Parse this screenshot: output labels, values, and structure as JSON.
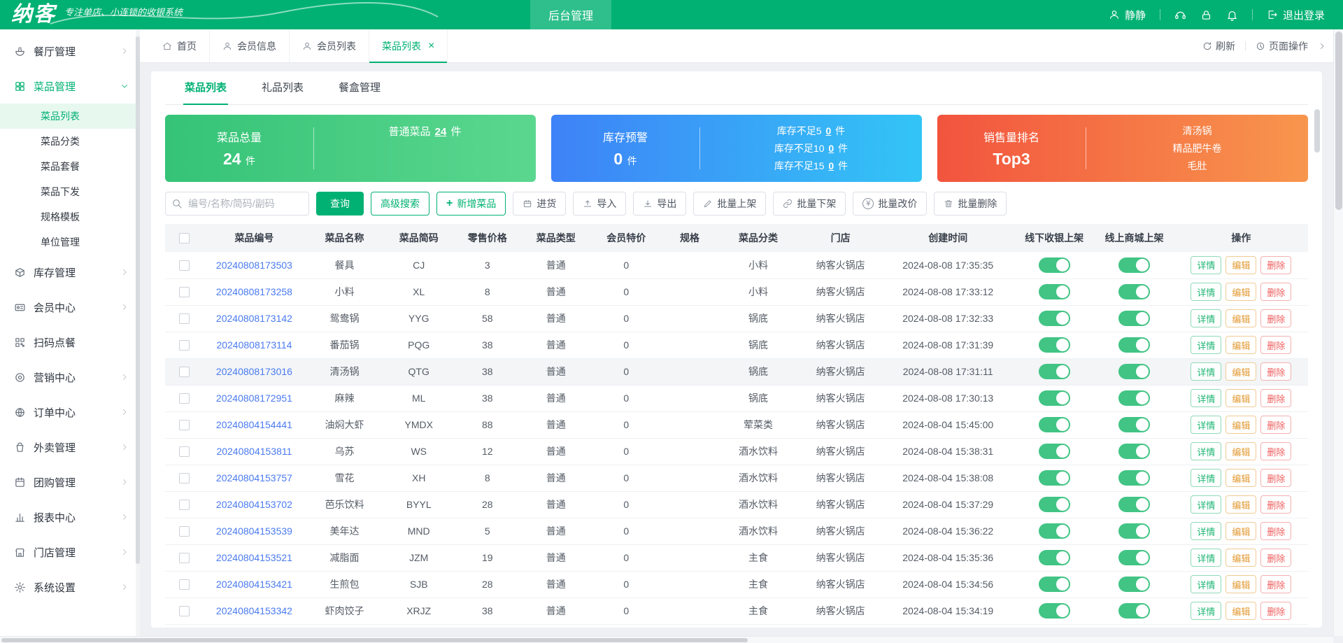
{
  "header": {
    "logo": "纳客",
    "tagline": "专注单店、小连锁的收银系统",
    "admin_tab": "后台管理",
    "username": "静静",
    "logout_label": "退出登录"
  },
  "tab_bar": {
    "tabs": [
      {
        "label": "首页",
        "icon": "home",
        "active": false,
        "closable": false
      },
      {
        "label": "会员信息",
        "icon": "user",
        "active": false,
        "closable": false
      },
      {
        "label": "会员列表",
        "icon": "user",
        "active": false,
        "closable": false
      },
      {
        "label": "菜品列表",
        "icon": "",
        "active": true,
        "closable": true
      }
    ],
    "refresh_label": "刷新",
    "page_ops_label": "页面操作"
  },
  "sidebar": {
    "items": [
      {
        "label": "餐厅管理",
        "icon": "restaurant",
        "expandable": true,
        "expanded": false
      },
      {
        "label": "菜品管理",
        "icon": "dish",
        "expandable": true,
        "expanded": true,
        "children": [
          {
            "label": "菜品列表",
            "active": true
          },
          {
            "label": "菜品分类",
            "active": false
          },
          {
            "label": "菜品套餐",
            "active": false
          },
          {
            "label": "菜品下发",
            "active": false
          },
          {
            "label": "规格模板",
            "active": false
          },
          {
            "label": "单位管理",
            "active": false
          }
        ]
      },
      {
        "label": "库存管理",
        "icon": "inventory",
        "expandable": true,
        "expanded": false
      },
      {
        "label": "会员中心",
        "icon": "member",
        "expandable": true,
        "expanded": false
      },
      {
        "label": "扫码点餐",
        "icon": "qr",
        "expandable": false,
        "expanded": false
      },
      {
        "label": "营销中心",
        "icon": "marketing",
        "expandable": true,
        "expanded": false
      },
      {
        "label": "订单中心",
        "icon": "order",
        "expandable": true,
        "expanded": false
      },
      {
        "label": "外卖管理",
        "icon": "takeout",
        "expandable": true,
        "expanded": false
      },
      {
        "label": "团购管理",
        "icon": "group",
        "expandable": true,
        "expanded": false
      },
      {
        "label": "报表中心",
        "icon": "report",
        "expandable": true,
        "expanded": false
      },
      {
        "label": "门店管理",
        "icon": "store",
        "expandable": true,
        "expanded": false
      },
      {
        "label": "系统设置",
        "icon": "settings",
        "expandable": true,
        "expanded": false
      }
    ]
  },
  "subtabs": [
    {
      "label": "菜品列表",
      "active": true
    },
    {
      "label": "礼品列表",
      "active": false
    },
    {
      "label": "餐盒管理",
      "active": false
    }
  ],
  "stat_cards": [
    {
      "theme": "green",
      "left_title": "菜品总量",
      "left_value": "24",
      "left_unit": "件",
      "right_lines": [
        {
          "label": "普通菜品",
          "value": "24",
          "unit": "件"
        }
      ]
    },
    {
      "theme": "blue",
      "left_title": "库存预警",
      "left_value": "0",
      "left_unit": "件",
      "right_lines": [
        {
          "label": "库存不足5",
          "value": "0",
          "unit": "件"
        },
        {
          "label": "库存不足10",
          "value": "0",
          "unit": "件"
        },
        {
          "label": "库存不足15",
          "value": "0",
          "unit": "件"
        }
      ]
    },
    {
      "theme": "orange",
      "left_title": "销售量排名",
      "left_value": "Top3",
      "left_unit": "",
      "right_lines": [
        {
          "label": "清汤锅"
        },
        {
          "label": "精品肥牛卷"
        },
        {
          "label": "毛肚"
        }
      ]
    }
  ],
  "toolbar": {
    "search_placeholder": "编号/名称/简码/副码",
    "query_label": "查询",
    "advanced_search_label": "高级搜索",
    "add_dish_label": "新增菜品",
    "batch_buttons": [
      {
        "label": "进货",
        "icon": "purchase"
      },
      {
        "label": "导入",
        "icon": "import"
      },
      {
        "label": "导出",
        "icon": "export"
      },
      {
        "label": "批量上架",
        "icon": "pencil"
      },
      {
        "label": "批量下架",
        "icon": "link"
      },
      {
        "label": "批量改价",
        "icon": "yen"
      },
      {
        "label": "批量删除",
        "icon": "trash"
      }
    ]
  },
  "table": {
    "columns": [
      "菜品编号",
      "菜品名称",
      "菜品简码",
      "零售价格",
      "菜品类型",
      "会员特价",
      "规格",
      "菜品分类",
      "门店",
      "创建时间",
      "线下收银上架",
      "线上商城上架",
      "操作"
    ],
    "actions": [
      "详情",
      "编辑",
      "删除"
    ],
    "rows": [
      {
        "id": "20240808173503",
        "name": "餐具",
        "code": "CJ",
        "price": "3",
        "type": "普通",
        "member_price": "0",
        "spec": "",
        "category": "小料",
        "store": "纳客火锅店",
        "created": "2024-08-08 17:35:35",
        "offline_on": true,
        "online_on": true,
        "highlighted": false
      },
      {
        "id": "20240808173258",
        "name": "小料",
        "code": "XL",
        "price": "8",
        "type": "普通",
        "member_price": "0",
        "spec": "",
        "category": "小料",
        "store": "纳客火锅店",
        "created": "2024-08-08 17:33:12",
        "offline_on": true,
        "online_on": true,
        "highlighted": false
      },
      {
        "id": "20240808173142",
        "name": "鸳鸯锅",
        "code": "YYG",
        "price": "58",
        "type": "普通",
        "member_price": "0",
        "spec": "",
        "category": "锅底",
        "store": "纳客火锅店",
        "created": "2024-08-08 17:32:33",
        "offline_on": true,
        "online_on": true,
        "highlighted": false
      },
      {
        "id": "20240808173114",
        "name": "番茄锅",
        "code": "PQG",
        "price": "38",
        "type": "普通",
        "member_price": "0",
        "spec": "",
        "category": "锅底",
        "store": "纳客火锅店",
        "created": "2024-08-08 17:31:39",
        "offline_on": true,
        "online_on": true,
        "highlighted": false
      },
      {
        "id": "20240808173016",
        "name": "清汤锅",
        "code": "QTG",
        "price": "38",
        "type": "普通",
        "member_price": "0",
        "spec": "",
        "category": "锅底",
        "store": "纳客火锅店",
        "created": "2024-08-08 17:31:11",
        "offline_on": true,
        "online_on": true,
        "highlighted": true
      },
      {
        "id": "20240808172951",
        "name": "麻辣",
        "code": "ML",
        "price": "38",
        "type": "普通",
        "member_price": "0",
        "spec": "",
        "category": "锅底",
        "store": "纳客火锅店",
        "created": "2024-08-08 17:30:13",
        "offline_on": true,
        "online_on": true,
        "highlighted": false
      },
      {
        "id": "20240804154441",
        "name": "油焖大虾",
        "code": "YMDX",
        "price": "88",
        "type": "普通",
        "member_price": "0",
        "spec": "",
        "category": "荤菜类",
        "store": "纳客火锅店",
        "created": "2024-08-04 15:45:00",
        "offline_on": true,
        "online_on": true,
        "highlighted": false
      },
      {
        "id": "20240804153811",
        "name": "乌苏",
        "code": "WS",
        "price": "12",
        "type": "普通",
        "member_price": "0",
        "spec": "",
        "category": "酒水饮料",
        "store": "纳客火锅店",
        "created": "2024-08-04 15:38:31",
        "offline_on": true,
        "online_on": true,
        "highlighted": false
      },
      {
        "id": "20240804153757",
        "name": "雪花",
        "code": "XH",
        "price": "8",
        "type": "普通",
        "member_price": "0",
        "spec": "",
        "category": "酒水饮料",
        "store": "纳客火锅店",
        "created": "2024-08-04 15:38:08",
        "offline_on": true,
        "online_on": true,
        "highlighted": false
      },
      {
        "id": "20240804153702",
        "name": "芭乐饮料",
        "code": "BYYL",
        "price": "28",
        "type": "普通",
        "member_price": "0",
        "spec": "",
        "category": "酒水饮料",
        "store": "纳客火锅店",
        "created": "2024-08-04 15:37:29",
        "offline_on": true,
        "online_on": true,
        "highlighted": false
      },
      {
        "id": "20240804153539",
        "name": "美年达",
        "code": "MND",
        "price": "5",
        "type": "普通",
        "member_price": "0",
        "spec": "",
        "category": "酒水饮料",
        "store": "纳客火锅店",
        "created": "2024-08-04 15:36:22",
        "offline_on": true,
        "online_on": true,
        "highlighted": false
      },
      {
        "id": "20240804153521",
        "name": "减脂面",
        "code": "JZM",
        "price": "19",
        "type": "普通",
        "member_price": "0",
        "spec": "",
        "category": "主食",
        "store": "纳客火锅店",
        "created": "2024-08-04 15:35:36",
        "offline_on": true,
        "online_on": true,
        "highlighted": false
      },
      {
        "id": "20240804153421",
        "name": "生煎包",
        "code": "SJB",
        "price": "28",
        "type": "普通",
        "member_price": "0",
        "spec": "",
        "category": "主食",
        "store": "纳客火锅店",
        "created": "2024-08-04 15:34:56",
        "offline_on": true,
        "online_on": true,
        "highlighted": false
      },
      {
        "id": "20240804153342",
        "name": "虾肉饺子",
        "code": "XRJZ",
        "price": "38",
        "type": "普通",
        "member_price": "0",
        "spec": "",
        "category": "主食",
        "store": "纳客火锅店",
        "created": "2024-08-04 15:34:19",
        "offline_on": true,
        "online_on": true,
        "highlighted": false
      }
    ]
  },
  "colors": {
    "brand_green": "#00b173",
    "card_green_start": "#35c377",
    "card_green_end": "#5bd78f",
    "card_blue_start": "#3e82f7",
    "card_blue_end": "#33c5f6",
    "card_orange_start": "#f2543e",
    "card_orange_end": "#f8964d",
    "link_blue": "#4a7bf0",
    "toggle_green": "#41c484",
    "detail_green": "#1db573",
    "edit_orange": "#e29a33",
    "delete_red": "#ef5e5e"
  }
}
